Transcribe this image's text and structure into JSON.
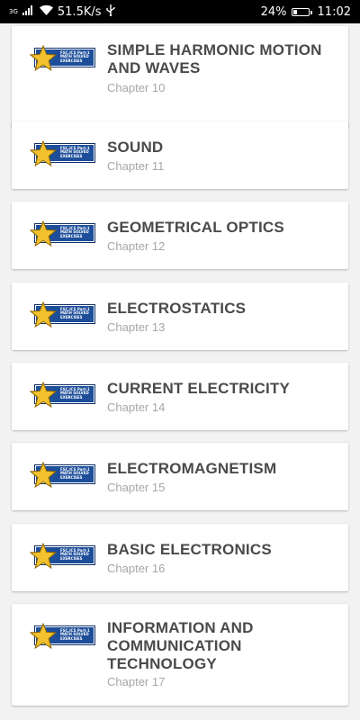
{
  "status_bar": {
    "network": "3G",
    "speed": "51.5K/s",
    "battery": "24%",
    "battery_level": 0.24,
    "time": "11:02"
  },
  "thumbnail": {
    "line1": "FSC.ICS Part-1",
    "line2": "MATH SOLVED",
    "line3": "EXERCISES",
    "badge_color": "#1d4e9a",
    "star_color": "#f2c12e"
  },
  "chapters": [
    {
      "title": "SIMPLE HARMONIC MOTION AND WAVES",
      "subtitle": "Chapter 10"
    },
    {
      "title": "SOUND",
      "subtitle": "Chapter 11"
    },
    {
      "title": "GEOMETRICAL OPTICS",
      "subtitle": "Chapter 12"
    },
    {
      "title": "ELECTROSTATICS",
      "subtitle": "Chapter 13"
    },
    {
      "title": "CURRENT ELECTRICITY",
      "subtitle": "Chapter 14"
    },
    {
      "title": "ELECTROMAGNETISM",
      "subtitle": "Chapter 15"
    },
    {
      "title": "BASIC ELECTRONICS",
      "subtitle": "Chapter 16"
    },
    {
      "title": "INFORMATION AND COMMUNICATION TECHNOLOGY",
      "subtitle": "Chapter 17"
    }
  ]
}
